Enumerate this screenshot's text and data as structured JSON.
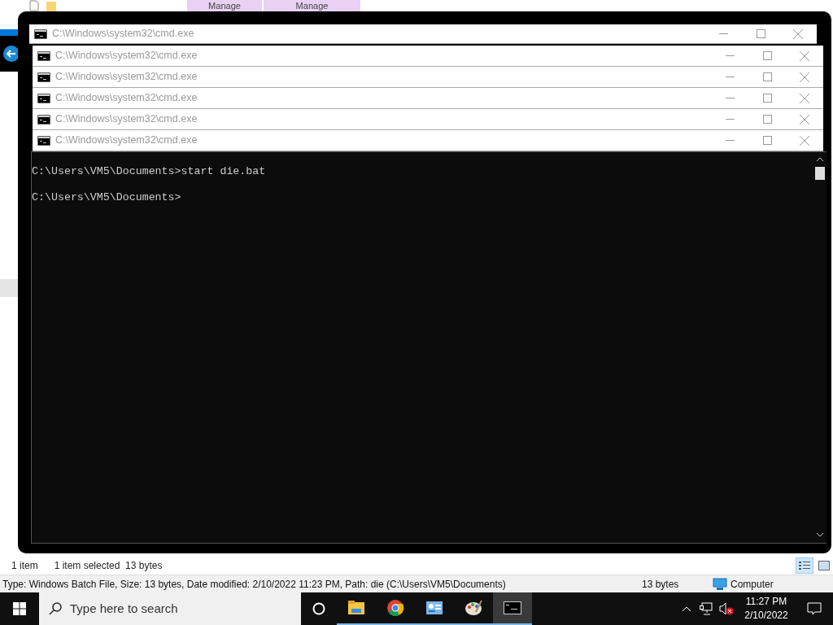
{
  "explorer": {
    "ribbon_tabs": [
      "Manage",
      "Manage"
    ],
    "status_bar": {
      "item_count": "1 item",
      "selection": "1 item selected  13 bytes"
    },
    "details_bar": {
      "info": "Type: Windows Batch File, Size: 13 bytes, Date modified: 2/10/2022 11:23 PM, Path: die (C:\\Users\\VM5\\Documents)",
      "size": "13 bytes",
      "location": "Computer"
    }
  },
  "cmd_windows": [
    {
      "title": "C:\\Windows\\system32\\cmd.exe"
    },
    {
      "title": "C:\\Windows\\system32\\cmd.exe"
    },
    {
      "title": "C:\\Windows\\system32\\cmd.exe"
    },
    {
      "title": "C:\\Windows\\system32\\cmd.exe"
    },
    {
      "title": "C:\\Windows\\system32\\cmd.exe"
    },
    {
      "title": "C:\\Windows\\system32\\cmd.exe"
    }
  ],
  "console": {
    "lines": [
      "C:\\Users\\VM5\\Documents>start die.bat",
      "C:\\Users\\VM5\\Documents>"
    ]
  },
  "taskbar": {
    "search_placeholder": "Type here to search",
    "apps": [
      {
        "kind": "explorer",
        "selected": false
      },
      {
        "kind": "chrome",
        "selected": false
      },
      {
        "kind": "panel",
        "selected": false
      },
      {
        "kind": "paint",
        "selected": false
      },
      {
        "kind": "cmd",
        "selected": true
      }
    ],
    "clock": {
      "time": "11:27 PM",
      "date": "2/10/2022"
    }
  }
}
